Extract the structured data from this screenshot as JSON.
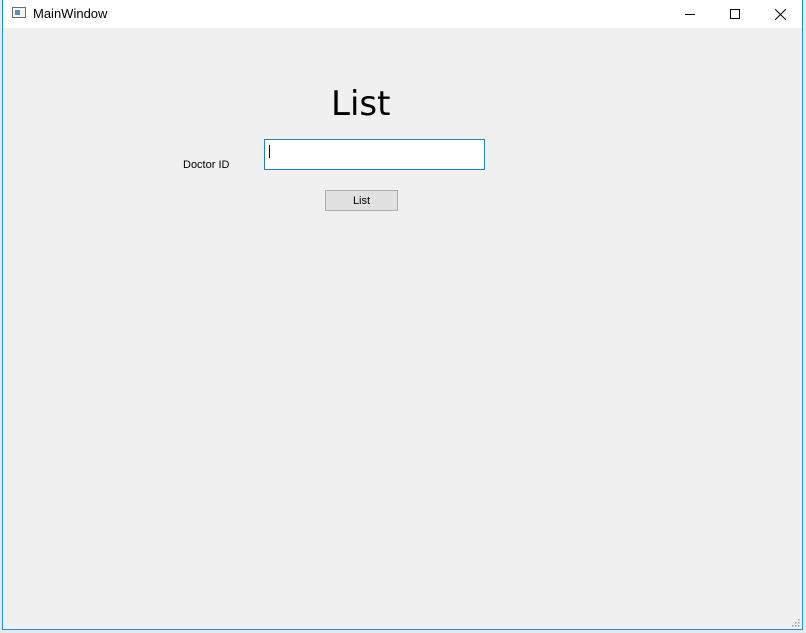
{
  "window": {
    "title": "MainWindow",
    "icons": {
      "app": "app-window-icon",
      "minimize": "minimize-icon",
      "maximize": "maximize-icon",
      "close": "close-icon"
    }
  },
  "form": {
    "heading": "List",
    "doctor_id_label": "Doctor ID",
    "doctor_id_value": "",
    "doctor_id_placeholder": "",
    "submit_label": "List"
  },
  "colors": {
    "window_border": "#1f8fd6",
    "input_border": "#2a7fb8",
    "background": "#f0f0f0"
  }
}
